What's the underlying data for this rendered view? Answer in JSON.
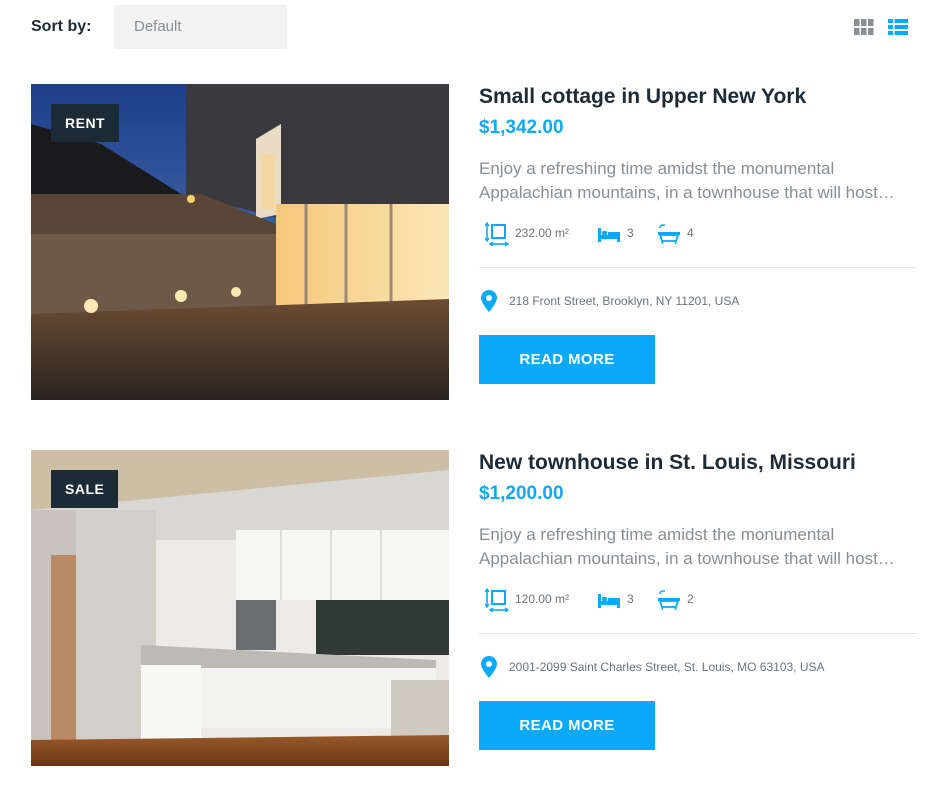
{
  "toolbar": {
    "sort_label": "Sort by:",
    "sort_value": "Default",
    "views": [
      "grid-view-icon",
      "list-view-icon"
    ],
    "active_view": "list-view-icon"
  },
  "colors": {
    "accent": "#0aa9f9",
    "price": "#0fa9f4",
    "badge_bg": "#1c2b36",
    "text_dark": "#1c2b36",
    "text_muted": "#888e94",
    "select_bg": "#f2f2f2"
  },
  "listings": [
    {
      "badge": "RENT",
      "title": "Small cottage in Upper New York",
      "price": "$1,342.00",
      "description_line1": "Enjoy a refreshing time amidst the monumental",
      "description_line2": "Appalachian mountains, in a townhouse that will host…",
      "area": "232.00 m²",
      "bedrooms": "3",
      "bathrooms": "4",
      "address": "218 Front Street, Brooklyn, NY 11201, USA",
      "button": "READ MORE",
      "image": "modern house exterior at dusk"
    },
    {
      "badge": "SALE",
      "title": "New townhouse in St. Louis, Missouri",
      "price": "$1,200.00",
      "description_line1": "Enjoy a refreshing time amidst the monumental",
      "description_line2": "Appalachian mountains, in a townhouse that will host…",
      "area": "120.00 m²",
      "bedrooms": "3",
      "bathrooms": "2",
      "address": "2001-2099 Saint Charles Street, St. Louis, MO 63103, USA",
      "button": "READ MORE",
      "image": "modern white kitchen interior"
    }
  ]
}
